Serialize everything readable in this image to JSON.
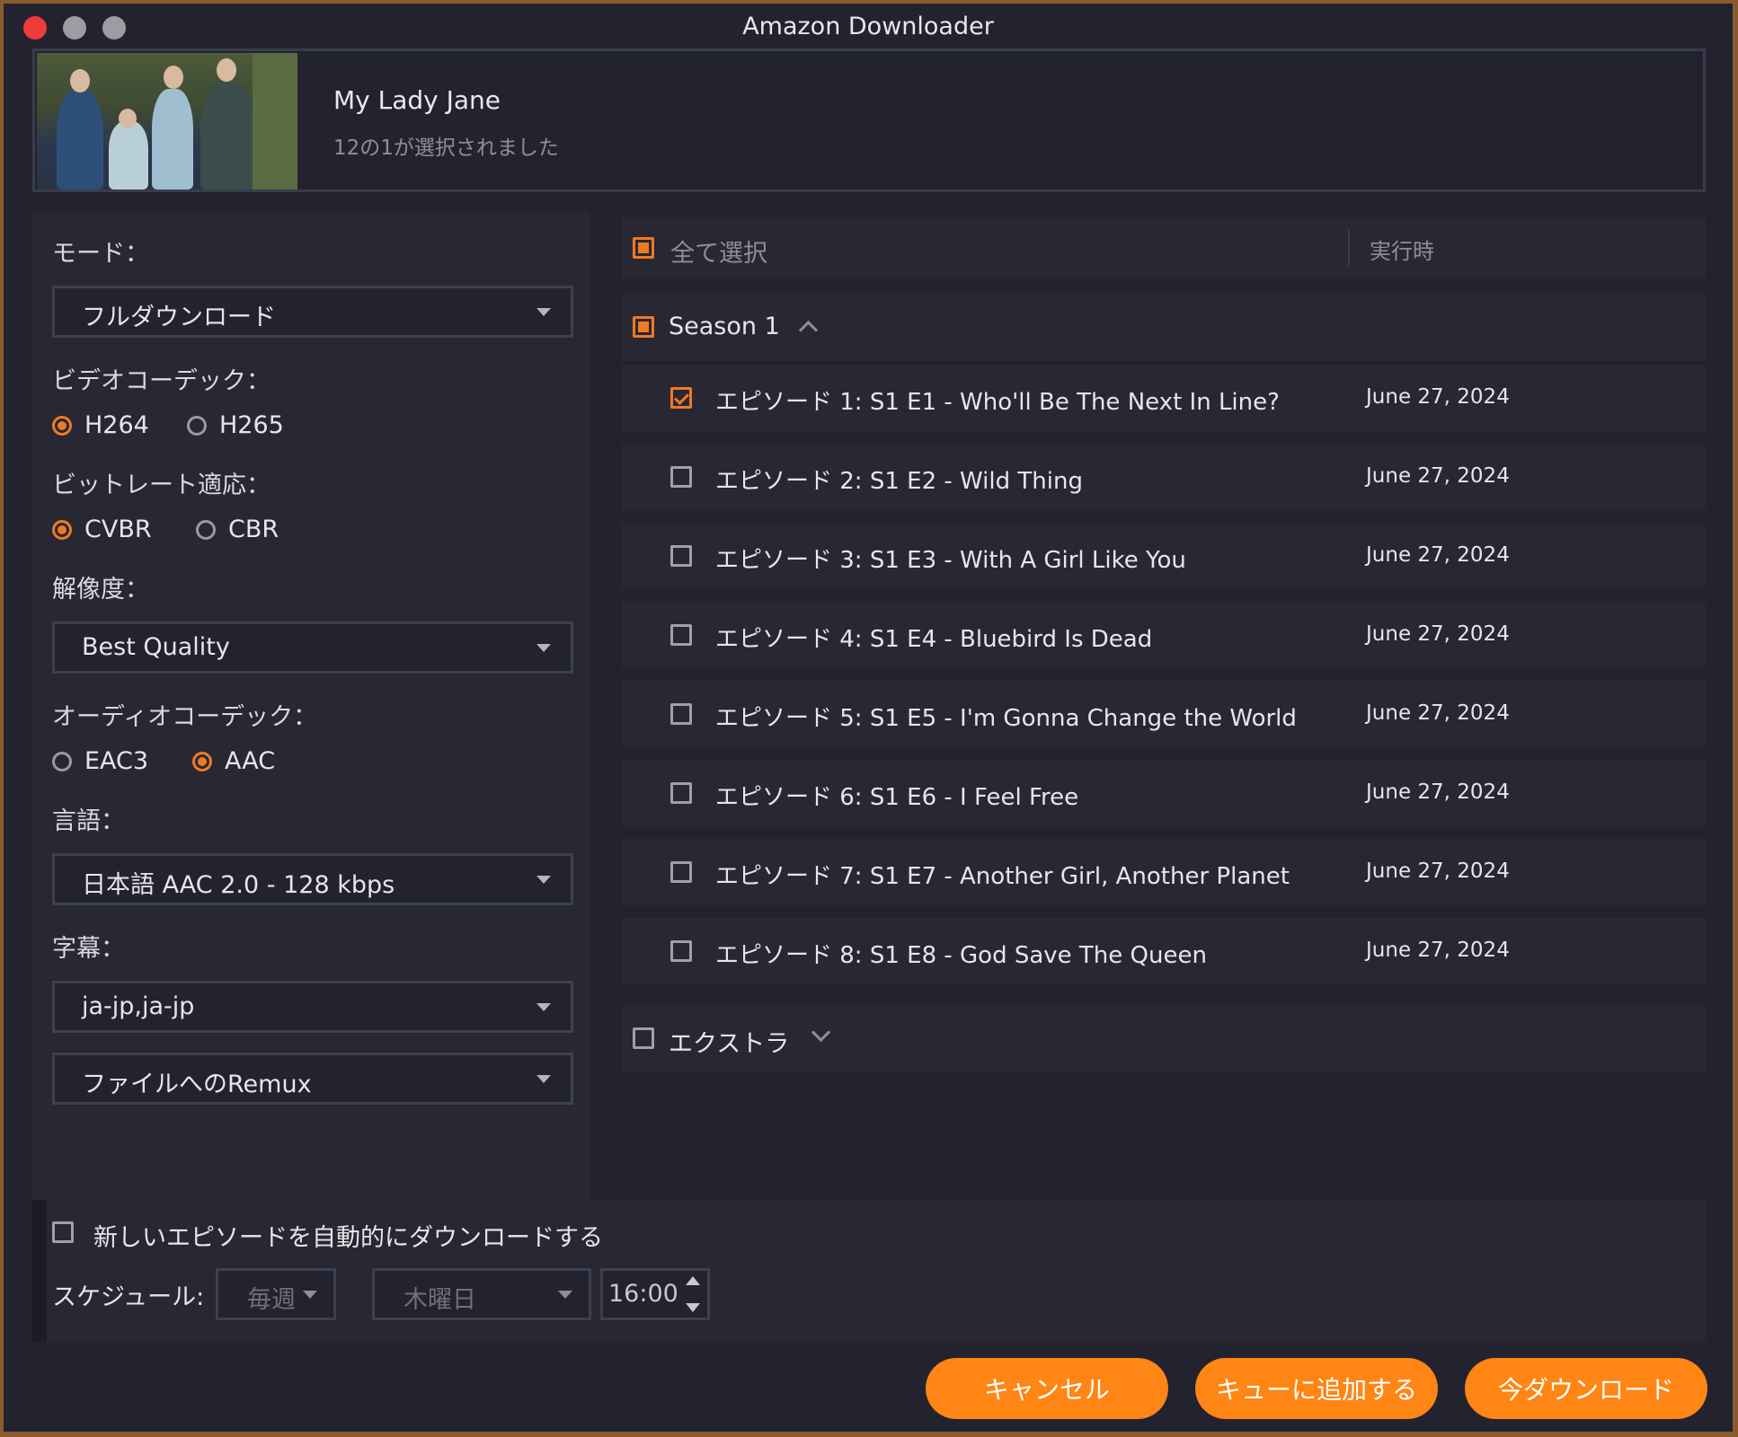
{
  "window": {
    "title": "Amazon Downloader"
  },
  "header": {
    "show_title": "My Lady Jane",
    "selection_status": "12の1が選択されました"
  },
  "settings": {
    "mode_label": "モード：",
    "mode_value": "フルダウンロード",
    "video_codec_label": "ビデオコーデック：",
    "video_codec_options": [
      "H264",
      "H265"
    ],
    "video_codec_selected": "H264",
    "bitrate_label": "ビットレート適応：",
    "bitrate_options": [
      "CVBR",
      "CBR"
    ],
    "bitrate_selected": "CVBR",
    "resolution_label": "解像度：",
    "resolution_value": "Best Quality",
    "audio_codec_label": "オーディオコーデック：",
    "audio_codec_options": [
      "EAC3",
      "AAC"
    ],
    "audio_codec_selected": "AAC",
    "language_label": "言語：",
    "language_value": "日本語 AAC 2.0 - 128 kbps",
    "subtitle_label": "字幕：",
    "subtitle_value": "ja-jp,ja-jp",
    "remux_value": "ファイルへのRemux"
  },
  "list": {
    "select_all_label": "全て選択",
    "runtime_header": "実行時",
    "season_label": "Season 1",
    "episodes": [
      {
        "title": "エピソード 1: S1 E1 - Who'll Be The Next In Line?",
        "date": "June 27, 2024",
        "checked": true
      },
      {
        "title": "エピソード 2: S1 E2 - Wild Thing",
        "date": "June 27, 2024",
        "checked": false
      },
      {
        "title": "エピソード 3: S1 E3 - With A Girl Like You",
        "date": "June 27, 2024",
        "checked": false
      },
      {
        "title": "エピソード 4: S1 E4 - Bluebird Is Dead",
        "date": "June 27, 2024",
        "checked": false
      },
      {
        "title": "エピソード 5: S1 E5 - I'm Gonna Change the World",
        "date": "June 27, 2024",
        "checked": false
      },
      {
        "title": "エピソード 6: S1 E6 - I Feel Free",
        "date": "June 27, 2024",
        "checked": false
      },
      {
        "title": "エピソード 7: S1 E7 - Another Girl, Another Planet",
        "date": "June 27, 2024",
        "checked": false
      },
      {
        "title": "エピソード 8: S1 E8 - God Save The Queen",
        "date": "June 27, 2024",
        "checked": false
      }
    ],
    "extras_label": "エクストラ"
  },
  "schedule": {
    "auto_download_label": "新しいエピソードを自動的にダウンロードする",
    "schedule_label": "スケジュール:",
    "frequency_value": "毎週",
    "day_value": "木曜日",
    "time_value": "16:00"
  },
  "buttons": {
    "cancel": "キャンセル",
    "add_to_queue": "キューに追加する",
    "download_now": "今ダウンロード"
  },
  "colors": {
    "accent": "#ff8514",
    "background": "#22232f",
    "panel": "#272833"
  }
}
